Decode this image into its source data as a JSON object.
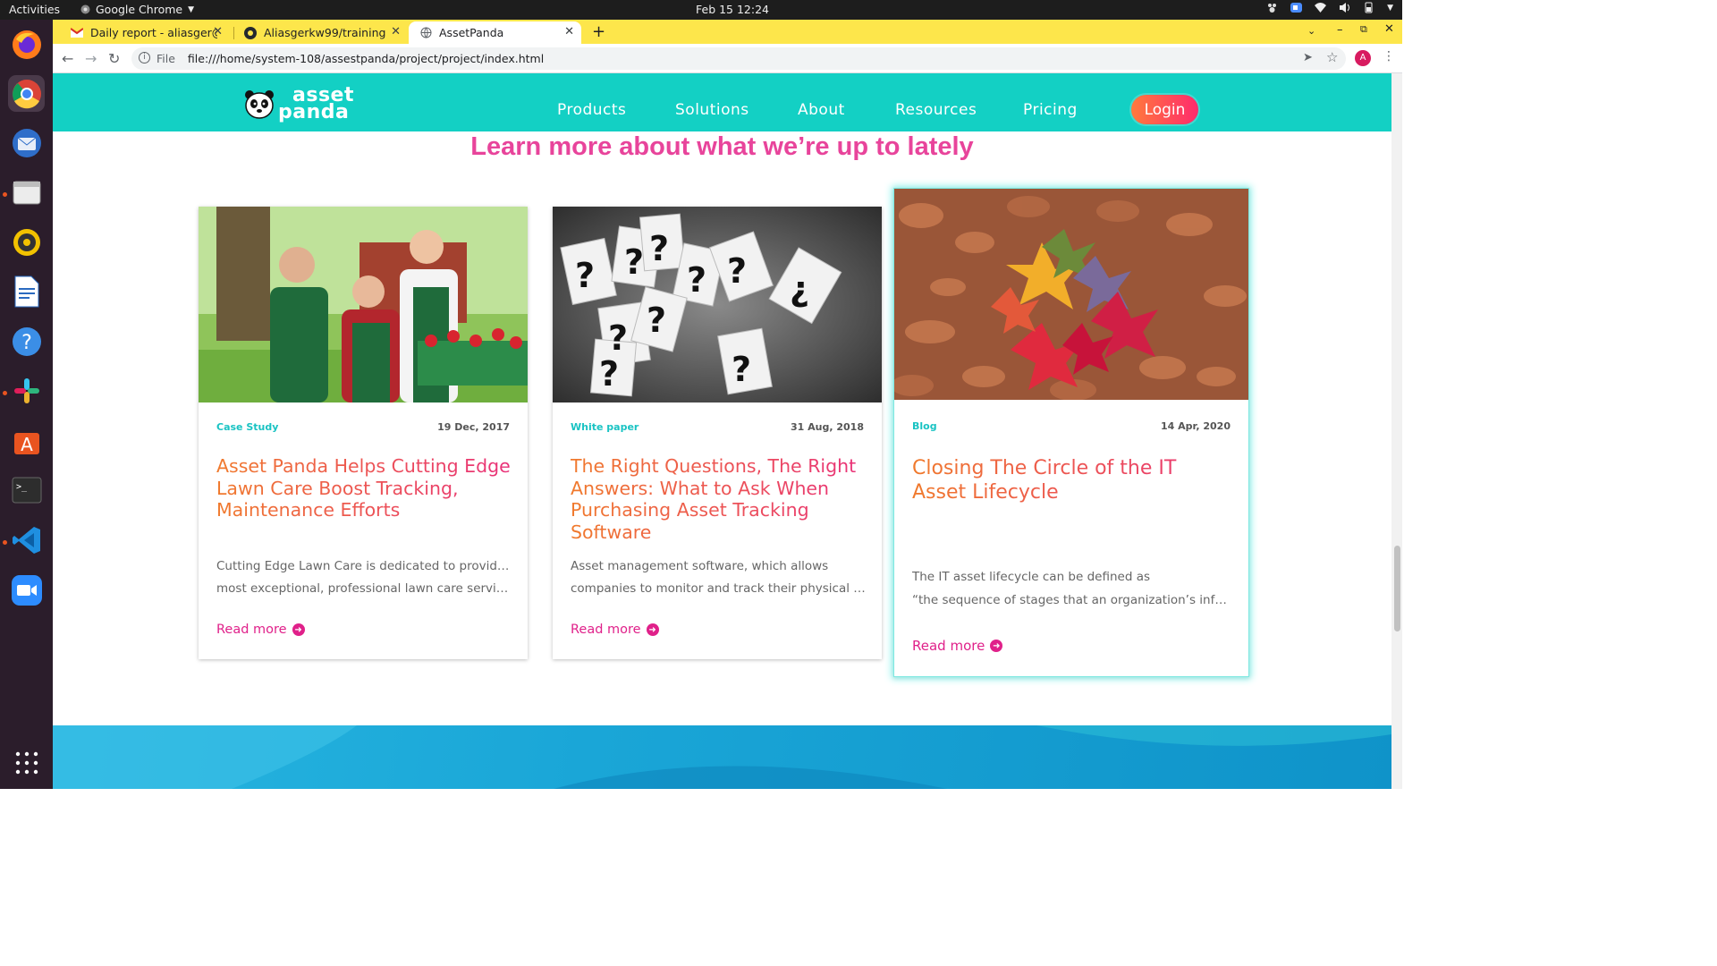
{
  "system": {
    "activities": "Activities",
    "app_menu": "Google Chrome",
    "clock": "Feb 15  12:24"
  },
  "browser": {
    "tabs": [
      {
        "title": "Daily report - aliasger@w",
        "icon": "gmail-icon"
      },
      {
        "title": "Aliasgerkw99/training",
        "icon": "github-icon"
      },
      {
        "title": "AssetPanda",
        "icon": "globe-icon",
        "active": true
      }
    ],
    "scheme_label": "File",
    "url": "file:///home/system-108/assestpanda/project/project/index.html",
    "profile_initial": "A"
  },
  "site": {
    "logo_line1": "asset",
    "logo_line2": "panda",
    "nav": [
      "Products",
      "Solutions",
      "About",
      "Resources",
      "Pricing"
    ],
    "login": "Login",
    "heading": "Learn more about what we’re up to lately"
  },
  "cards": [
    {
      "category": "Case Study",
      "date": "19 Dec, 2017",
      "title": "Asset Panda Helps Cutting Edge Lawn Care Boost Tracking, Maintenance Efforts",
      "excerpt_line1": "Cutting Edge Lawn Care is dedicated to providing the",
      "excerpt_line2": "most exceptional, professional lawn care service in t...",
      "read_more": "Read more"
    },
    {
      "category": "White paper",
      "date": "31 Aug, 2018",
      "title": "The Right Questions, The Right Answers: What to Ask When Purchasing Asset Tracking Software",
      "excerpt_line1": "Asset management software, which allows",
      "excerpt_line2": "companies to monitor and track their physical and d...",
      "read_more": "Read more"
    },
    {
      "category": "Blog",
      "date": "14 Apr, 2020",
      "title": "Closing The Circle of the IT Asset Lifecycle",
      "excerpt_line1": "The IT asset lifecycle can be defined as",
      "excerpt_line2": "“the sequence of stages that an organization’s infor...",
      "read_more": "Read more"
    }
  ],
  "colors": {
    "nav_bg": "#13d0c4",
    "heading": "#e8449b",
    "category": "#19c3c3",
    "read_more": "#e0218a",
    "title_gradient_start": "#f07a2c",
    "title_gradient_end": "#e9307a",
    "tabstrip": "#fde64b"
  }
}
